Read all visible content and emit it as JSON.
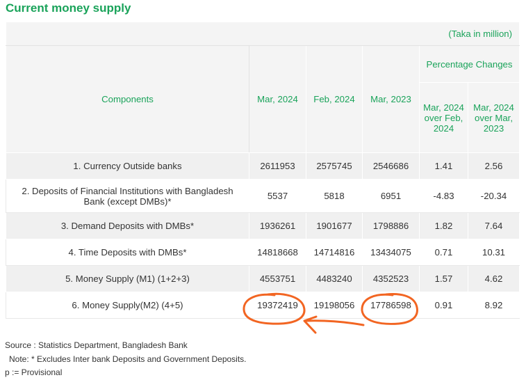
{
  "title": "Current money supply",
  "table": {
    "unit_note": "(Taka in million)",
    "headers": {
      "components": "Components",
      "mar_2024": "Mar, 2024",
      "feb_2024": "Feb, 2024",
      "mar_2023": "Mar, 2023",
      "percentage_changes": "Percentage Changes",
      "change_over_feb": "Mar, 2024 over Feb, 2024",
      "change_over_mar": "Mar, 2024 over Mar, 2023"
    },
    "rows": [
      {
        "component": "1. Currency Outside banks",
        "mar_2024": "2611953",
        "feb_2024": "2575745",
        "mar_2023": "2546686",
        "chg_feb": "1.41",
        "chg_mar": "2.56"
      },
      {
        "component": "2. Deposits of Financial Institutions with Bangladesh Bank (except DMBs)*",
        "mar_2024": "5537",
        "feb_2024": "5818",
        "mar_2023": "6951",
        "chg_feb": "-4.83",
        "chg_mar": "-20.34"
      },
      {
        "component": "3. Demand Deposits with DMBs*",
        "mar_2024": "1936261",
        "feb_2024": "1901677",
        "mar_2023": "1798886",
        "chg_feb": "1.82",
        "chg_mar": "7.64"
      },
      {
        "component": "4. Time Deposits with DMBs*",
        "mar_2024": "14818668",
        "feb_2024": "14714816",
        "mar_2023": "13434075",
        "chg_feb": "0.71",
        "chg_mar": "10.31"
      },
      {
        "component": "5. Money Supply (M1) (1+2+3)",
        "mar_2024": "4553751",
        "feb_2024": "4483240",
        "mar_2023": "4352523",
        "chg_feb": "1.57",
        "chg_mar": "4.62"
      },
      {
        "component": "6. Money Supply(M2) (4+5)",
        "mar_2024": "19372419",
        "feb_2024": "19198056",
        "mar_2023": "17786598",
        "chg_feb": "0.91",
        "chg_mar": "8.92"
      }
    ]
  },
  "notes": {
    "source": "Source : Statistics Department, Bangladesh Bank",
    "note": "Note: * Excludes Inter bank Deposits and Government Deposits.",
    "provisional": "p := Provisional"
  },
  "colors": {
    "accent": "#1aa35a",
    "annotation": "#f26522"
  }
}
